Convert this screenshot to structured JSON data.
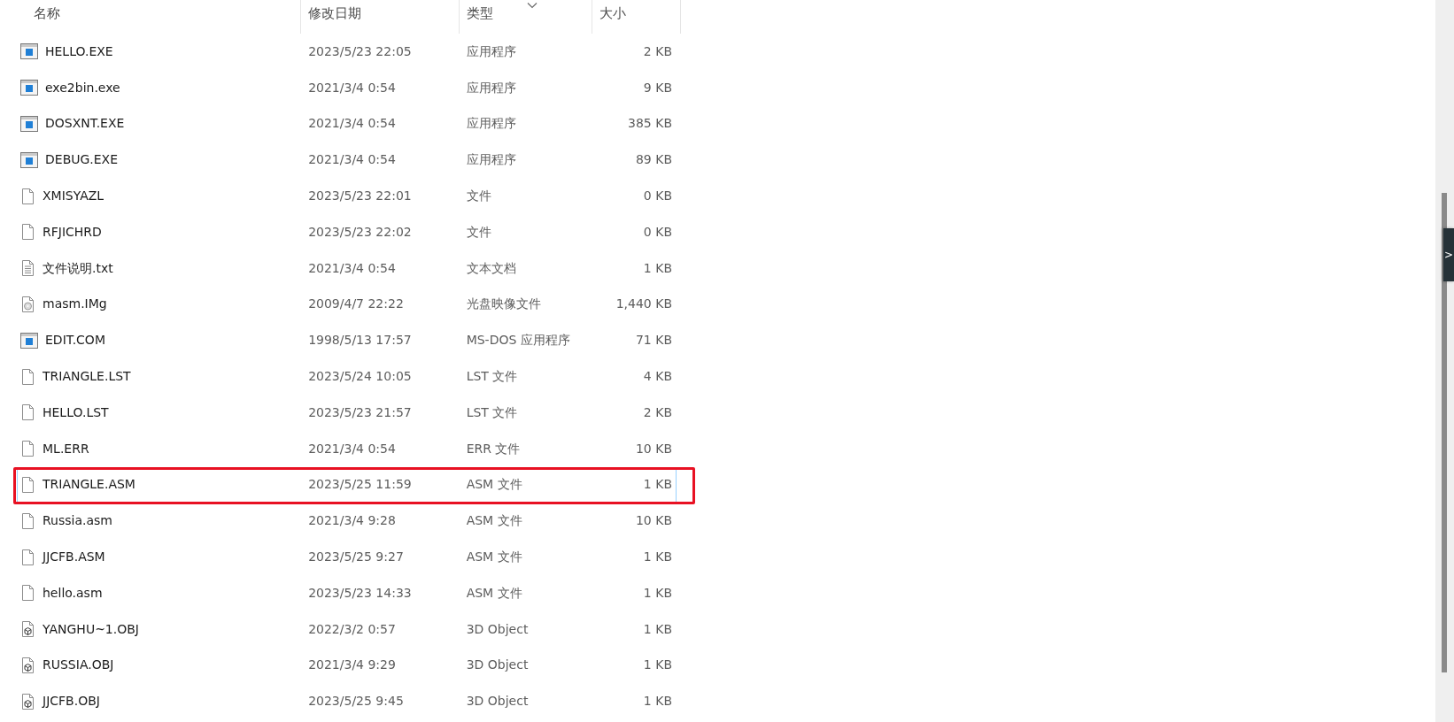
{
  "columns": [
    {
      "label": "名称",
      "sorted": false
    },
    {
      "label": "修改日期",
      "sorted": false
    },
    {
      "label": "类型",
      "sorted": true
    },
    {
      "label": "大小",
      "sorted": false
    }
  ],
  "rows": [
    {
      "kind": "app",
      "name": "HELLO.EXE",
      "date": "2023/5/23 22:05",
      "type": "应用程序",
      "size": "2 KB",
      "selected": false,
      "marked": false
    },
    {
      "kind": "app",
      "name": "exe2bin.exe",
      "date": "2021/3/4 0:54",
      "type": "应用程序",
      "size": "9 KB",
      "selected": false,
      "marked": false
    },
    {
      "kind": "app",
      "name": "DOSXNT.EXE",
      "date": "2021/3/4 0:54",
      "type": "应用程序",
      "size": "385 KB",
      "selected": false,
      "marked": false
    },
    {
      "kind": "app",
      "name": "DEBUG.EXE",
      "date": "2021/3/4 0:54",
      "type": "应用程序",
      "size": "89 KB",
      "selected": false,
      "marked": false
    },
    {
      "kind": "file",
      "name": "XMISYAZL",
      "date": "2023/5/23 22:01",
      "type": "文件",
      "size": "0 KB",
      "selected": false,
      "marked": false
    },
    {
      "kind": "file",
      "name": "RFJICHRD",
      "date": "2023/5/23 22:02",
      "type": "文件",
      "size": "0 KB",
      "selected": false,
      "marked": false
    },
    {
      "kind": "text",
      "name": "文件说明.txt",
      "date": "2021/3/4 0:54",
      "type": "文本文档",
      "size": "1 KB",
      "selected": false,
      "marked": false
    },
    {
      "kind": "disc",
      "name": "masm.IMg",
      "date": "2009/4/7 22:22",
      "type": "光盘映像文件",
      "size": "1,440 KB",
      "selected": false,
      "marked": false
    },
    {
      "kind": "app",
      "name": "EDIT.COM",
      "date": "1998/5/13 17:57",
      "type": "MS-DOS 应用程序",
      "size": "71 KB",
      "selected": false,
      "marked": false
    },
    {
      "kind": "file",
      "name": "TRIANGLE.LST",
      "date": "2023/5/24 10:05",
      "type": "LST 文件",
      "size": "4 KB",
      "selected": false,
      "marked": false
    },
    {
      "kind": "file",
      "name": "HELLO.LST",
      "date": "2023/5/23 21:57",
      "type": "LST 文件",
      "size": "2 KB",
      "selected": false,
      "marked": false
    },
    {
      "kind": "file",
      "name": "ML.ERR",
      "date": "2021/3/4 0:54",
      "type": "ERR 文件",
      "size": "10 KB",
      "selected": false,
      "marked": false
    },
    {
      "kind": "file",
      "name": "TRIANGLE.ASM",
      "date": "2023/5/25 11:59",
      "type": "ASM 文件",
      "size": "1 KB",
      "selected": true,
      "marked": true
    },
    {
      "kind": "file",
      "name": "Russia.asm",
      "date": "2021/3/4 9:28",
      "type": "ASM 文件",
      "size": "10 KB",
      "selected": false,
      "marked": false
    },
    {
      "kind": "file",
      "name": "JJCFB.ASM",
      "date": "2023/5/25 9:27",
      "type": "ASM 文件",
      "size": "1 KB",
      "selected": false,
      "marked": false
    },
    {
      "kind": "file",
      "name": "hello.asm",
      "date": "2023/5/23 14:33",
      "type": "ASM 文件",
      "size": "1 KB",
      "selected": false,
      "marked": false
    },
    {
      "kind": "object3d",
      "name": "YANGHU~1.OBJ",
      "date": "2022/3/2 0:57",
      "type": "3D Object",
      "size": "1 KB",
      "selected": false,
      "marked": false
    },
    {
      "kind": "object3d",
      "name": "RUSSIA.OBJ",
      "date": "2021/3/4 9:29",
      "type": "3D Object",
      "size": "1 KB",
      "selected": false,
      "marked": false
    },
    {
      "kind": "object3d",
      "name": "JJCFB.OBJ",
      "date": "2023/5/25 9:45",
      "type": "3D Object",
      "size": "1 KB",
      "selected": false,
      "marked": false
    }
  ],
  "side_tab": {
    "label": ">"
  }
}
